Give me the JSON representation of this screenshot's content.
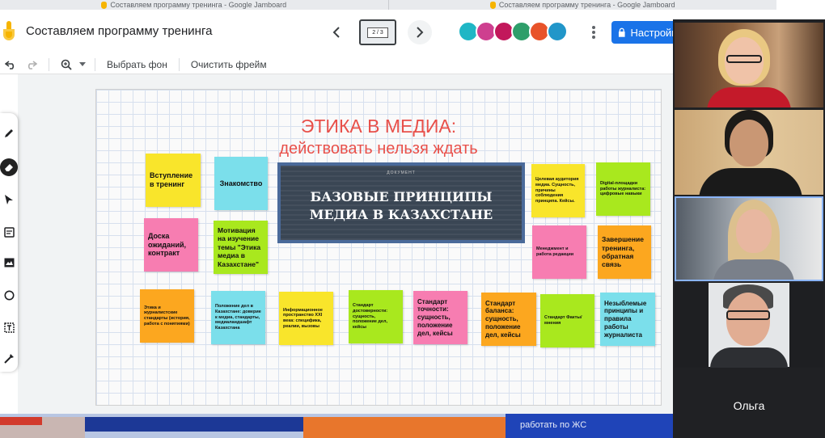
{
  "browser": {
    "tabs": [
      {
        "title": "Составляем программу тренинга - Google Jamboard"
      },
      {
        "title": "Составляем программу тренинга - Google Jamboard"
      }
    ]
  },
  "header": {
    "title": "Составляем программу тренинга",
    "frame_counter": "2 / 3",
    "prev_icon": "chevron-left-icon",
    "next_icon": "chevron-right-icon",
    "more_icon": "more-vert-icon",
    "share_label": "Настройк",
    "collaborators": [
      {
        "color": "#1fb6c5"
      },
      {
        "color": "#ce3f8f"
      },
      {
        "color": "#c2185b"
      },
      {
        "color": "#2e9e6a"
      },
      {
        "color": "#e8532a"
      },
      {
        "color": "#2196c9"
      }
    ]
  },
  "toolbar": {
    "undo_icon": "undo-icon",
    "redo_icon": "redo-icon",
    "zoom_icon": "zoom-icon",
    "set_background_label": "Выбрать фон",
    "clear_frame_label": "Очистить фрейм"
  },
  "tools": [
    "pen-icon",
    "eraser-icon",
    "select-icon",
    "sticky-note-icon",
    "image-icon",
    "circle-icon",
    "textbox-icon",
    "laser-icon"
  ],
  "frame": {
    "title_line1": "ЭТИКА В МЕДИА:",
    "title_line2": "действовать нельзя ждать",
    "poster": {
      "kicker": "ДОКУМЕНТ",
      "title": "БАЗОВЫЕ ПРИНЦИПЫ МЕДИА В КАЗАХСТАНЕ"
    },
    "notes": [
      {
        "text": "Вступление в тренинг",
        "color": "yellow"
      },
      {
        "text": "Знакомство",
        "color": "cyan"
      },
      {
        "text": "Доска ожиданий, контракт",
        "color": "pink"
      },
      {
        "text": "Мотивация на изучение темы \"Этика медиа в Казахстане\"",
        "color": "green"
      },
      {
        "text": "Целевая аудитория медиа. Сущность, причины соблюдения принципа. Кейсы.",
        "color": "yellow"
      },
      {
        "text": "Digital-площадки работы журналиста: цифровые навыки",
        "color": "green"
      },
      {
        "text": "Менеджмент и работа редакции",
        "color": "pink"
      },
      {
        "text": "Завершение тренинга, обратная связь",
        "color": "orange"
      },
      {
        "text": "Этика и журналистские стандарты (история, работа с понятиями)",
        "color": "orange"
      },
      {
        "text": "Положение дел в Казахстане: доверие к медиа, стандарты, медиаландшафт Казахстана",
        "color": "cyan"
      },
      {
        "text": "Информационное пространство XXI века: специфика, реалии, вызовы",
        "color": "yellow"
      },
      {
        "text": "Стандарт достоверности: сущность, положение дел, кейсы",
        "color": "green"
      },
      {
        "text": "Стандарт точности: сущность, положение дел, кейсы",
        "color": "pink"
      },
      {
        "text": "Стандарт баланса: сущность, положение дел, кейсы",
        "color": "orange"
      },
      {
        "text": "Стандарт Факты/мнения",
        "color": "green"
      },
      {
        "text": "Незыблемые принципы и правила работы журналиста",
        "color": "cyan"
      }
    ]
  },
  "bottom_banner": {
    "text": "работать по ЖС"
  },
  "video_call": {
    "participants": [
      {
        "tile": "participant-1"
      },
      {
        "tile": "participant-2"
      },
      {
        "tile": "participant-3"
      },
      {
        "tile": "participant-4"
      }
    ],
    "self_name": "Ольга"
  },
  "colors": {
    "accent": "#1a73e8",
    "title_red": "#e8504a",
    "yellow": "#f9e52b",
    "cyan": "#7bdfeb",
    "pink": "#f77db1",
    "green": "#a9e81e",
    "orange": "#fca71f"
  }
}
